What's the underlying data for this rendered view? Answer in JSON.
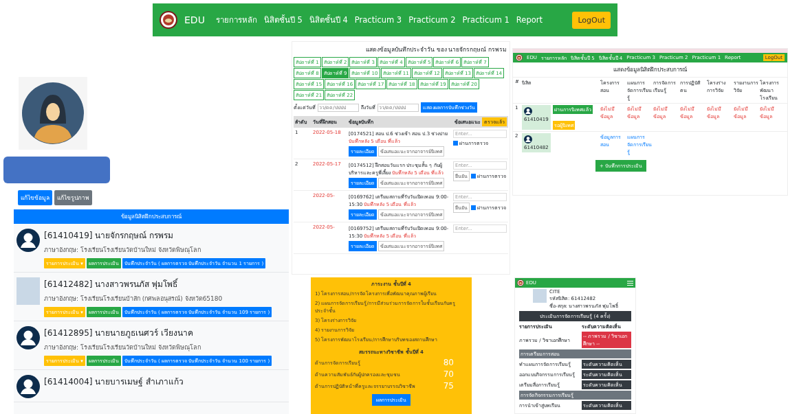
{
  "navbar": {
    "brand": "EDU",
    "items": [
      "รายการหลัก",
      "นิสิตชั้นปี 5",
      "นิสิตชั้นปี 4",
      "Practicum 3",
      "Practicum 2",
      "Practicum 1",
      "Report"
    ],
    "logout": "LogOut"
  },
  "profile": {
    "buttons": [
      {
        "label": "แก้ไขข้อมูล",
        "kind": "primary"
      },
      {
        "label": "แก้ไขรูปภาพ",
        "kind": "secondary"
      }
    ]
  },
  "student_list": {
    "header": "ข้อมูลนิสิตฝึกประสบการณ์",
    "students": [
      {
        "name": "[61410419] นายจักรกฤษณ์ กรพรม",
        "school": "ภาษาอังกฤษ: โรงเรียนโรงเรียนวัดบ้านใหม่ จังหวัดพิษณุโลก",
        "photo": false,
        "actions": [
          "รายการประเมิน ▾",
          "ผลการประเมิน",
          "บันทึกประจำวัน ( ผลการตรวจ บันทึกประจำวัน จำนวน 1 รายการ )"
        ]
      },
      {
        "name": "[61412482] นางสาวพรนภัส พุ่มโพธิ์",
        "school": "ภาษาอังกฤษ: โรงเรียนโรงเรียนบ้าสัก (กศพลอนุสรณ์) จังหวัด65180",
        "photo": true,
        "actions": [
          "รายการประเมิน ▾",
          "ผลการประเมิน",
          "บันทึกประจำวัน ( ผลการตรวจ บันทึกประจำวัน จำนวน 109 รายการ )"
        ]
      },
      {
        "name": "[61412895] นายนายภูธเนศวร์ เวียงนาค",
        "school": "ภาษาอังกฤษ: โรงเรียนโรงเรียนวัดบ้านใหม่ จังหวัดพิษณุโลก",
        "photo": false,
        "actions": [
          "รายการประเมิน ▾",
          "ผลการประเมิน",
          "บันทึกประจำวัน ( ผลการตรวจ บันทึกประจำวัน จำนวน 100 รายการ )"
        ]
      },
      {
        "name": "[61414004] นายบารเมษฐ์ สำเภาแก้ว",
        "photo": false
      }
    ]
  },
  "daily_log": {
    "title": "แสดงข้อมูลบันทึกประจำวัน ของ นายจักรกฤษณ์ กรพรม",
    "weeks": [
      {
        "label": "สัปดาห์ที่ 1",
        "selected": false
      },
      {
        "label": "สัปดาห์ที่ 2",
        "selected": false
      },
      {
        "label": "สัปดาห์ที่ 3",
        "selected": false
      },
      {
        "label": "สัปดาห์ที่ 4",
        "selected": false
      },
      {
        "label": "สัปดาห์ที่ 5",
        "selected": false
      },
      {
        "label": "สัปดาห์ที่ 6",
        "selected": false
      },
      {
        "label": "สัปดาห์ที่ 7",
        "selected": false
      },
      {
        "label": "สัปดาห์ที่ 8",
        "selected": false
      },
      {
        "label": "สัปดาห์ที่ 9",
        "selected": true
      },
      {
        "label": "สัปดาห์ที่ 10",
        "selected": false
      },
      {
        "label": "สัปดาห์ที่ 11",
        "selected": false
      },
      {
        "label": "สัปดาห์ที่ 12",
        "selected": false
      },
      {
        "label": "สัปดาห์ที่ 13",
        "selected": false
      },
      {
        "label": "สัปดาห์ที่ 14",
        "selected": false
      },
      {
        "label": "สัปดาห์ที่ 15",
        "selected": false
      },
      {
        "label": "สัปดาห์ที่ 16",
        "selected": false
      },
      {
        "label": "สัปดาห์ที่ 17",
        "selected": false
      },
      {
        "label": "สัปดาห์ที่ 18",
        "selected": false
      },
      {
        "label": "สัปดาห์ที่ 19",
        "selected": false
      },
      {
        "label": "สัปดาห์ที่ 20",
        "selected": false
      },
      {
        "label": "สัปดาห์ที่ 21",
        "selected": false
      },
      {
        "label": "สัปดาห์ที่ 22",
        "selected": false
      }
    ],
    "from_label": "ตั้งแต่วันที่",
    "from_placeholder": "วว/ดด/ปปปป",
    "to_label": "ถึงวันที่",
    "to_placeholder": "วว/ดด/ปปปป",
    "show_button": "แสดงผลการบันทึกช่วงวัน",
    "columns": [
      "ลำดับ",
      "วันที่ฝึกสอน",
      "ข้อมูลบันทึก",
      "ข้อเสนอแนะ"
    ],
    "checked_badge": "ตรวจแล้ว",
    "rows": [
      {
        "index": "1",
        "date": "2022-05-18",
        "text": "[0174521] สอน ป.6 ช่วงเช้า สอน ป.3 ช่วงบ่าย",
        "late": "บันทึกหลัง 5 เดือน ที่แล้ว",
        "detail": "รายละเอียด",
        "secondary": "ข้อเสนอแนะจากอาจารย์นิเทศ",
        "comment": "Enter...",
        "check_label": "ผ่านการตรวจ",
        "checked": true
      },
      {
        "index": "2",
        "date": "2022-05-17",
        "text": "[0174512] ฝึกสอนวันแรก ประชุมสั้น ๆ กับผู้บริหารและครูพี่เลี้ยง",
        "late": "บันทึกหลัง 5 เดือน ที่แล้ว",
        "detail": "รายละเอียด",
        "secondary": "ข้อเสนอแนะจากอาจารย์นิเทศ",
        "comment": "Enter...",
        "confirm": "ยืนยัน",
        "check_label": "ผ่านการตรวจ",
        "checked": true
      },
      {
        "date": "2022-05-",
        "text": "[0169762] เตรียมสถานที่รับวันเปิดเทอม 9:00-15:30",
        "late": "บันทึกหลัง 5 เดือน ที่แล้ว",
        "detail": "รายละเอียด",
        "secondary": "ข้อเสนอแนะจากอาจารย์นิเทศ",
        "comment": "Enter...",
        "confirm": "ยืนยัน",
        "check_label": "ผ่านการตรวจ",
        "checked": true
      },
      {
        "date": "2022-05-",
        "text": "[0169752] เตรียมสถานที่รับวันเปิดเทอม 9:00-15:30",
        "late": "บันทึกหลัง 5 เดือน ที่แล้ว",
        "detail": "รายละเอียด",
        "secondary": "ข้อเสนอแนะจากอาจารย์นิเทศ",
        "comment": "Enter..."
      }
    ]
  },
  "overview": {
    "nav": [
      "EDU",
      "รายการหลัก",
      "นิสิตชั้นปี 5",
      "นิสิตชั้นปี 4",
      "Practicum 3",
      "Practicum 2",
      "Practicum 1",
      "Report"
    ],
    "logout": "LogOut",
    "title": "แสดงข้อมูลนิสิตฝึกประสบการณ์",
    "columns": [
      "#",
      "นิสิต",
      "โครงการสอน",
      "แผนการจัดการเรียนรู้",
      "การจัดการเรียนรู้",
      "การปฏิบัติตน",
      "โครงร่างการวิจัย",
      "รายงานการวิจัย",
      "โครงการพัฒนาโรงเรียน"
    ],
    "students": [
      {
        "index": "1",
        "id": "61410419",
        "badges": [
          {
            "label": "ผ่านการนิเทศแล้ว",
            "kind": "success"
          },
          {
            "label": "รอผู้นิเทศ",
            "kind": "warning"
          }
        ],
        "cells": [
          "ยังไม่มีข้อมูล",
          "ยังไม่มีข้อมูล",
          "ยังไม่มีข้อมูล",
          "ยังไม่มีข้อมูล",
          "ยังไม่มีข้อมูล",
          "ยังไม่มีข้อมูล",
          "ยังไม่มีข้อมูล"
        ]
      },
      {
        "index": "2",
        "id": "61410482",
        "cells": [
          "ข้อมูลการสอน",
          "แผนการจัดการเรียนรู้"
        ]
      }
    ],
    "save_button": "+ บันทึกการประเมิน"
  },
  "workload": {
    "title": "ภาระงาน ชั้นปีที่ 4",
    "items": [
      "1) โครงการสอน/การจัดโครงการเพื่อพัฒนาคุณภาพผู้เรียน",
      "2) แผนการจัดการเรียนรู้/การมีส่วนร่วมการจัดการในชั้นเรียนกับครูประจำชั้น",
      "3) โครงร่างการวิจัย",
      "4) รายงานการวิจัย",
      "5) โครงการพัฒนาโรงเรียน/การศึกษาบริบทของสถานศึกษา"
    ],
    "competency_title": "สมรรถนะทางวิชาชีพ ชั้นปีที่ 4",
    "competencies": [
      {
        "label": "ด้านการจัดการเรียนรู้",
        "score": "80"
      },
      {
        "label": "ด้านความสัมพันธ์กับผู้ปกครองและชุมชน",
        "score": "70"
      },
      {
        "label": "ด้านการปฏิบัติหน้าที่ครูและจรรยาบรรณวิชาชีพ",
        "score": "75"
      }
    ],
    "button": "ผลการประเมิน"
  },
  "mobile": {
    "brand": "EDU",
    "info": [
      "CITE",
      "รหัสนิสิต: 61412482",
      "ชื่อ-สกุล: นางสาวพรนภัส พุ่มโพธิ์"
    ],
    "bar": "ประเมินการจัดการเรียนรู้ (4 ครั้ง)",
    "columns": [
      "รายการประเมิน",
      "ระดับความคิดเห็น"
    ],
    "overall_label": "ภาพรวม / วิชาเอกศึกษา",
    "overall_select": "-- ภาพรวม / วิชาเอกศึกษา --",
    "sections": [
      {
        "title": "การเตรียมการสอน",
        "items": [
          {
            "label": "ทำแผนการจัดการเรียนรู้",
            "select": "ระดับความคิดเห็น"
          },
          {
            "label": "ออกแบบกิจกรรมการเรียนรู้",
            "select": "ระดับความคิดเห็น"
          },
          {
            "label": "เตรียมสื่อการเรียนรู้",
            "select": "ระดับความคิดเห็น"
          }
        ]
      },
      {
        "title": "การจัดกิจกรรมการเรียนรู้",
        "items": [
          {
            "label": "การนำเข้าสู่บทเรียน",
            "select": "ระดับความคิดเห็น"
          }
        ]
      }
    ]
  }
}
